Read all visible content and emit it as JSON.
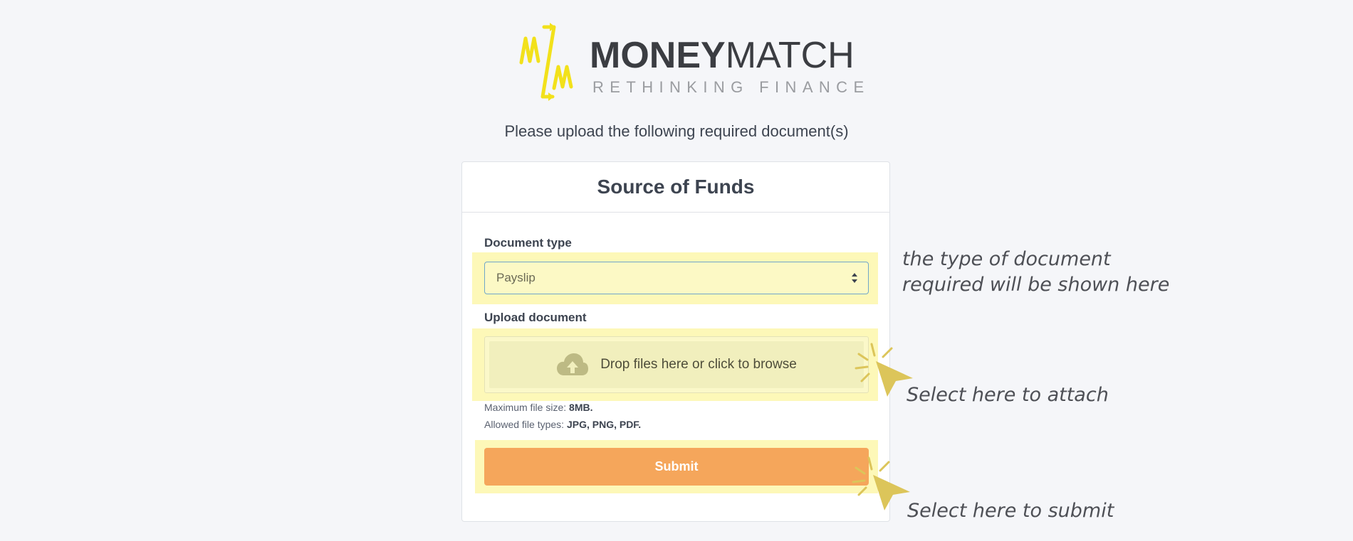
{
  "brand": {
    "name_bold": "MONEY",
    "name_light": "MATCH",
    "tagline": "RETHINKING FINANCE",
    "accent_color": "#f2e11b"
  },
  "instruction": "Please upload the following required document(s)",
  "card": {
    "title": "Source of Funds",
    "document_type": {
      "label": "Document type",
      "selected_value": "Payslip"
    },
    "upload": {
      "label": "Upload document",
      "dropzone_text": "Drop files here or click to browse",
      "icon": "cloud-upload-icon"
    },
    "limits": {
      "max_size_label": "Maximum file size:",
      "max_size_value": "8MB.",
      "file_types_label": "Allowed file types:",
      "file_types_value": "JPG, PNG, PDF."
    },
    "submit_label": "Submit",
    "submit_color": "#f5a65b"
  },
  "annotations": {
    "doc_type_line1": "the type of document",
    "doc_type_line2": "required will be shown here",
    "attach": "Select here to attach",
    "submit": "Select here to submit",
    "highlight_color": "#fdf8b8",
    "cursor_color": "#dcc55a"
  }
}
